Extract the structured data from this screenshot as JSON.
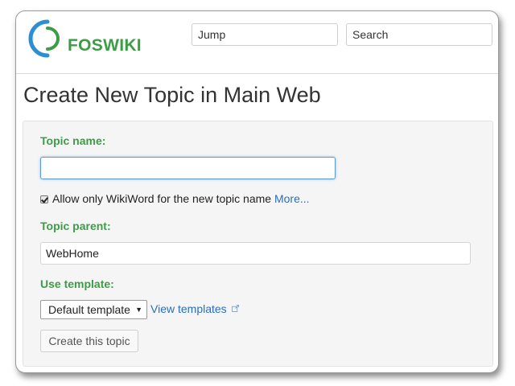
{
  "header": {
    "logo_text": "FOSWIKI",
    "jump_value": "Jump",
    "search_value": "Search"
  },
  "page": {
    "title": "Create New Topic in Main Web"
  },
  "form": {
    "topic_name_label": "Topic name:",
    "topic_name_value": "",
    "wikiword_checkbox_checked": true,
    "wikiword_label": "Allow only WikiWord for the new topic name",
    "wikiword_more_link": "More...",
    "topic_parent_label": "Topic parent:",
    "topic_parent_value": "WebHome",
    "use_template_label": "Use template:",
    "template_selected": "Default template",
    "view_templates_link": "View templates",
    "create_button": "Create this topic"
  },
  "colors": {
    "accent_green": "#3d9d47",
    "logo_blue": "#2d8fd0",
    "link_blue": "#2a6ebb"
  },
  "icons": {
    "logo": "foswiki-logo-icon",
    "checkbox": "checkbox-checked-icon",
    "select_caret": "caret-down-icon",
    "external_link": "external-link-icon"
  }
}
